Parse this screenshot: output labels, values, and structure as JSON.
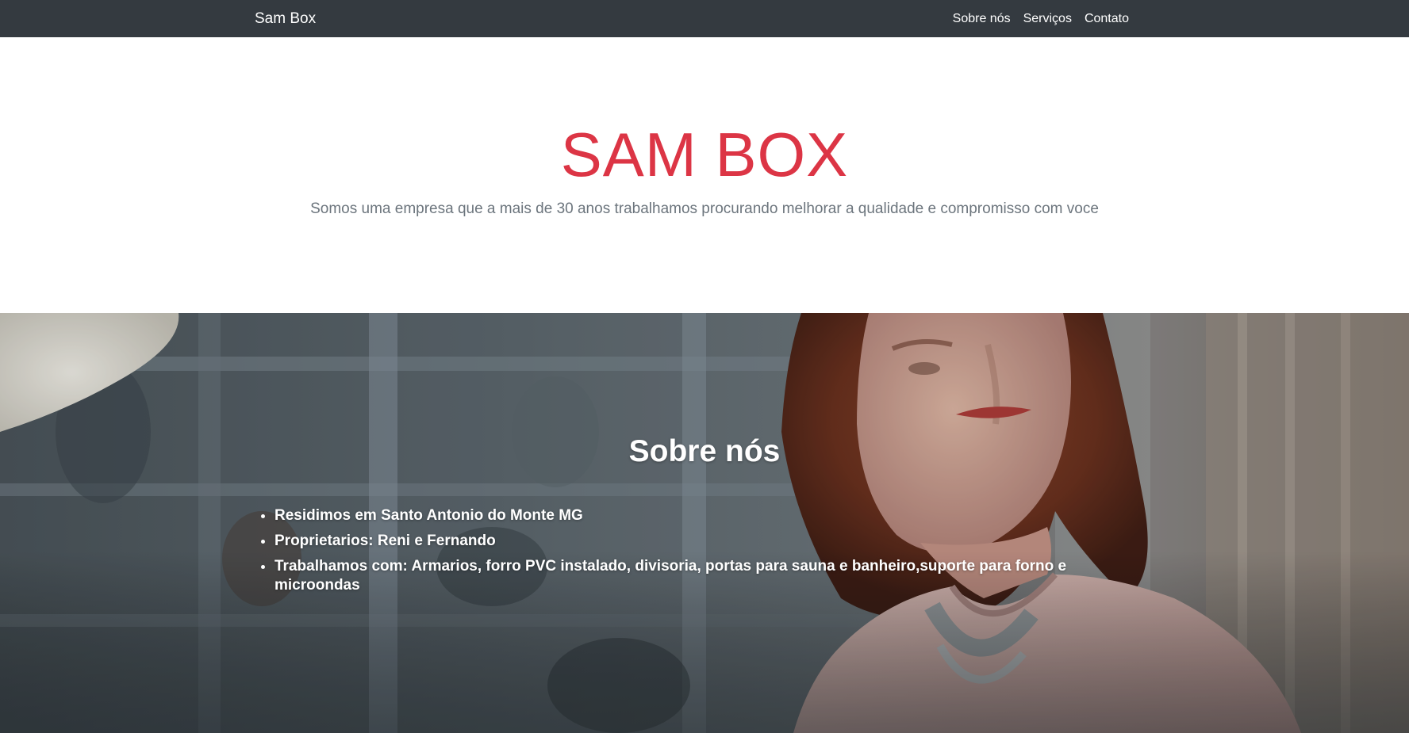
{
  "navbar": {
    "brand": "Sam Box",
    "links": [
      {
        "label": "Sobre nós"
      },
      {
        "label": "Serviços"
      },
      {
        "label": "Contato"
      }
    ]
  },
  "hero": {
    "title": "SAM BOX",
    "subtitle": "Somos uma empresa que a mais de 30 anos trabalhamos procurando melhorar a qualidade e compromisso com voce"
  },
  "about": {
    "title": "Sobre nós",
    "items": [
      {
        "text": "Residimos em Santo Antonio do Monte MG"
      },
      {
        "text": "Proprietarios: Reni e Fernando"
      },
      {
        "text": "Trabalhamos com: Armarios, forro PVC instalado, divisoria, portas para sauna e banheiro,suporte para forno e microondas"
      }
    ]
  },
  "colors": {
    "navbar_bg": "#343a40",
    "accent": "#dc3545",
    "muted_text": "#6c757d"
  }
}
